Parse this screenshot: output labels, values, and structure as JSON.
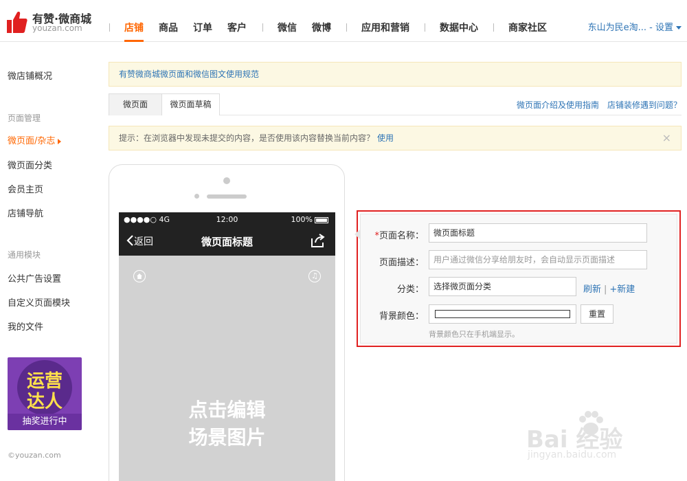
{
  "logo": {
    "title": "有赞·微商城",
    "subtitle": "youzan.com",
    "icon": "thumbs-up-icon",
    "brand_color": "#e02020"
  },
  "nav": {
    "items": [
      "店铺",
      "商品",
      "订单",
      "客户",
      "微信",
      "微博",
      "应用和营销",
      "数据中心",
      "商家社区"
    ],
    "active_index": 0,
    "right": "东山为民e淘... - 设置"
  },
  "sidebar": {
    "overview": "微店铺概况",
    "group1": "页面管理",
    "items1": [
      "微页面/杂志",
      "微页面分类",
      "会员主页",
      "店铺导航"
    ],
    "group2": "通用模块",
    "items2": [
      "公共广告设置",
      "自定义页面模块",
      "我的文件"
    ],
    "promo": {
      "line1": "运营",
      "line2": "达人",
      "footer": "抽奖进行中"
    },
    "copyright": "©youzan.com"
  },
  "notice_top": "有赞微商城微页面和微信图文使用规范",
  "tabs": [
    "微页面",
    "微页面草稿"
  ],
  "tab_links": [
    "微页面介绍及使用指南",
    "店铺装修遇到问题？"
  ],
  "notice_draft": {
    "text": "提示：在浏览器中发现未提交的内容，是否使用该内容替换当前内容？",
    "link": "使用",
    "close": "×"
  },
  "phone": {
    "status_left": "●●●●○ 4G",
    "time": "12:00",
    "battery": "100%",
    "back": "返回",
    "title": "微页面标题",
    "hint_line1": "点击编辑",
    "hint_line2": "场景图片"
  },
  "form": {
    "name_label": "页面名称：",
    "name_value": "微页面标题",
    "desc_label": "页面描述：",
    "desc_placeholder": "用户通过微信分享给朋友时，会自动显示页面描述",
    "cat_label": "分类：",
    "cat_value": "选择微页面分类",
    "refresh": "刷新",
    "new": "+新建",
    "bg_label": "背景颜色：",
    "reset": "重置",
    "bg_help": "背景颜色只在手机端显示。"
  },
  "watermark": {
    "main": "Bai  经验",
    "sub": "jingyan.baidu.com"
  }
}
